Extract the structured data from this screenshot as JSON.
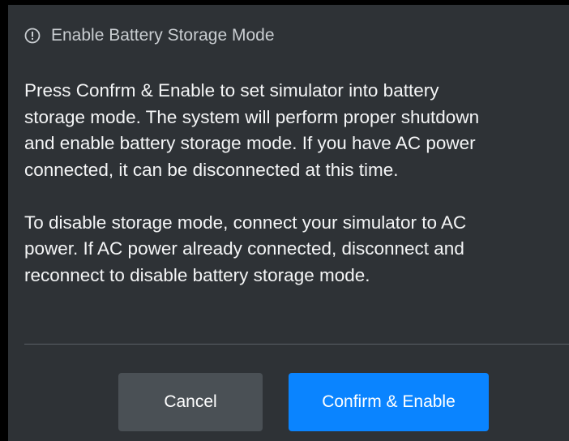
{
  "dialog": {
    "title": "Enable Battery Storage Mode",
    "header_icon": "alert-circle-icon",
    "body": [
      [
        "Press Confrm & Enable to set simulator into battery",
        "storage mode. The system will perform proper shutdown",
        "and enable battery storage mode. If you have AC power",
        "connected, it can be disconnected at this time."
      ],
      [
        "To disable storage mode, connect your simulator to AC",
        "power. If AC power already connected, disconnect and",
        "reconnect to disable battery storage mode."
      ]
    ],
    "buttons": {
      "cancel_label": "Cancel",
      "confirm_label": "Confirm & Enable"
    }
  },
  "colors": {
    "dialog_background": "#2e3236",
    "cancel_button": "#4a5055",
    "confirm_button": "#0a84ff",
    "title_text": "#c9cdd1",
    "body_text": "#f4f5f6",
    "divider": "#5b6066"
  }
}
